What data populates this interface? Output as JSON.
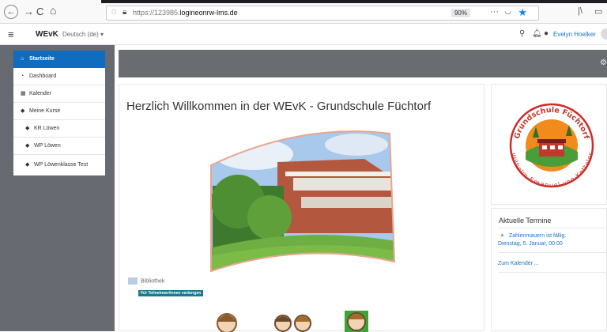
{
  "browser": {
    "back_icon": "←",
    "forward_icon": "→",
    "reload_icon": "C",
    "home_icon": "⌂",
    "url_prefix": "https://123985.",
    "url_domain": "logineonrw-lms.de",
    "zoom": "90%",
    "more_icon": "···"
  },
  "navbar": {
    "brand": "WEvK",
    "language": "Deutsch (de) ▾",
    "user_name": "Evelyn Hoelker"
  },
  "drawer": {
    "items": [
      {
        "label": "Startseite",
        "icon": "home-icon"
      },
      {
        "label": "Dashboard",
        "icon": "dashboard-icon"
      },
      {
        "label": "Kalender",
        "icon": "calendar-icon"
      },
      {
        "label": "Meine Kurse",
        "icon": "graduation-cap-icon"
      },
      {
        "label": "KR Löwen",
        "icon": "graduation-cap-icon"
      },
      {
        "label": "WP Löwen",
        "icon": "graduation-cap-icon"
      },
      {
        "label": "WP Löwenklasse Test",
        "icon": "graduation-cap-icon"
      }
    ]
  },
  "main": {
    "welcome_title": "Herzlich Willkommen in der WEvK - Grundschule Füchtorf",
    "library_label": "Bibliothek",
    "hidden_badge": "Für Teilnehmer/innen verborgen"
  },
  "logo": {
    "top_text": "Grundschule Füchtorf",
    "bottom_text": "Wilhelm-Emanuel-von-Ketteler"
  },
  "events": {
    "title": "Aktuelle Termine",
    "event_link": "Zahlenmauern ist fällig.",
    "event_date": "Dienstag, 5. Januar, 00:00",
    "calendar_link": "Zum Kalender ..."
  },
  "colors": {
    "accent": "#0f6cbf",
    "drawer_bg": "#676a70",
    "link": "#1a73c8",
    "badge": "#1c7a8f"
  }
}
